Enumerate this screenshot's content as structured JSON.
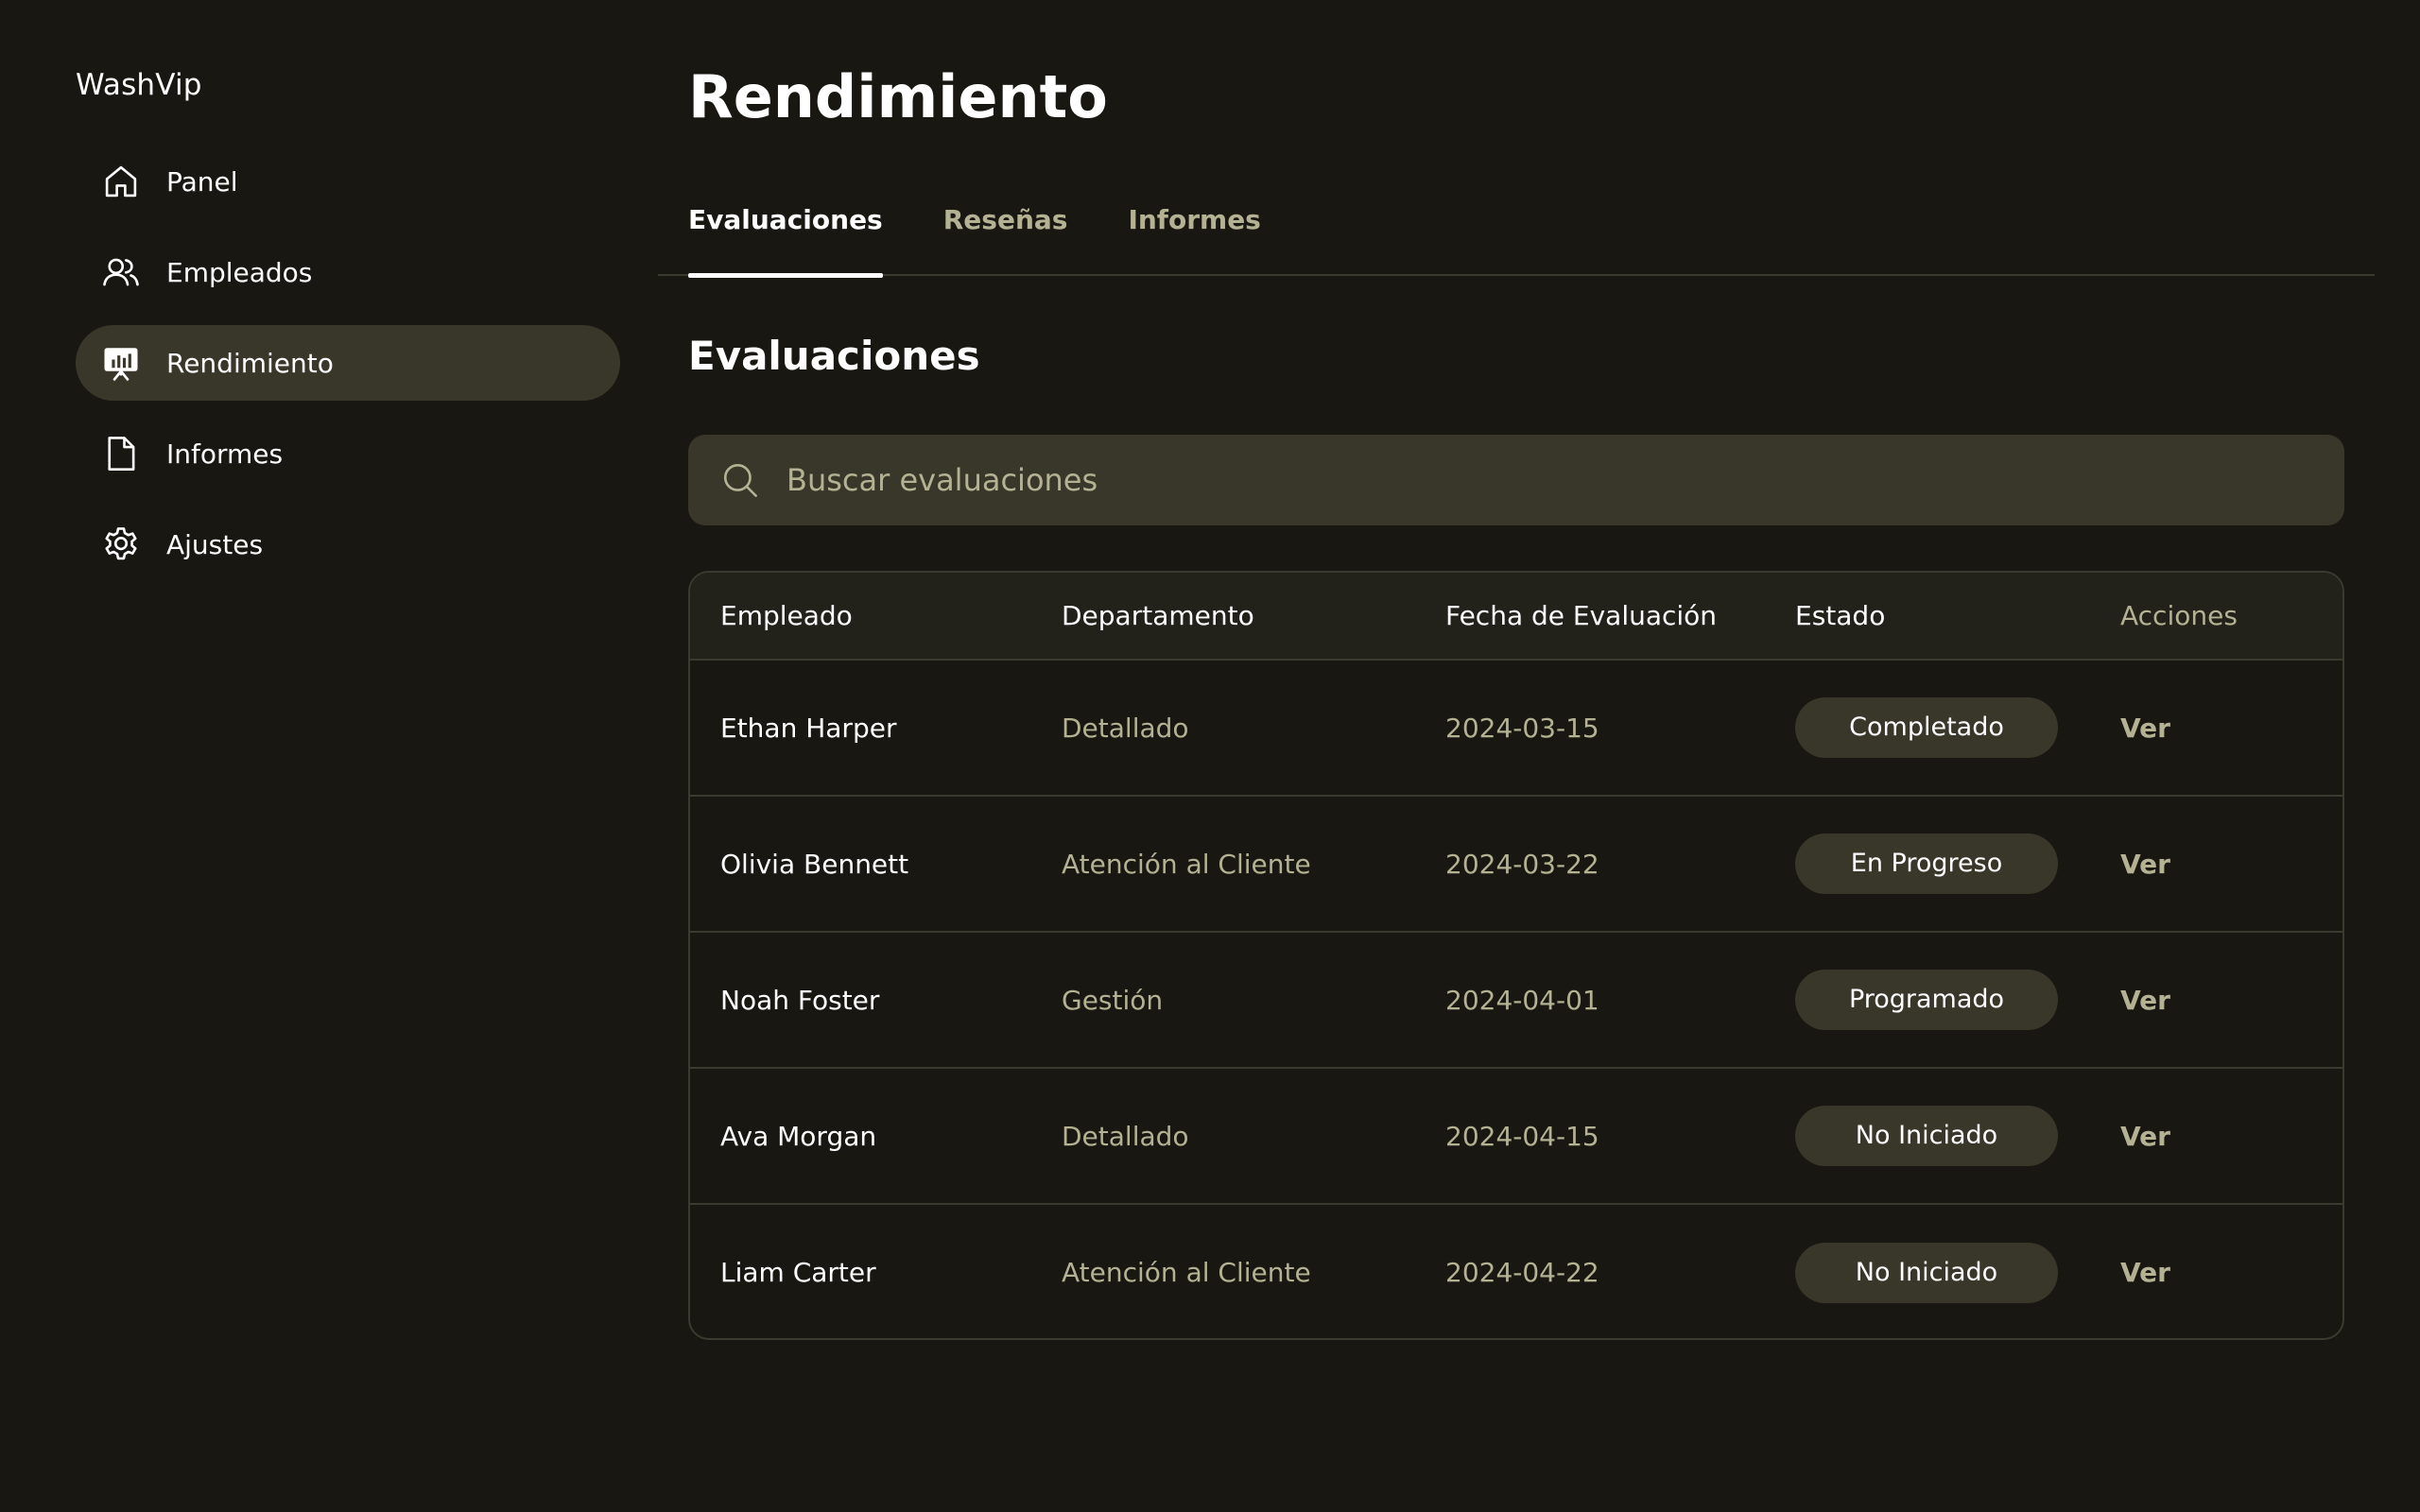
{
  "brand": "WashVip",
  "sidebar": {
    "items": [
      {
        "label": "Panel",
        "icon": "home-icon",
        "active": false
      },
      {
        "label": "Empleados",
        "icon": "users-icon",
        "active": false
      },
      {
        "label": "Rendimiento",
        "icon": "presentation-chart-icon",
        "active": true
      },
      {
        "label": "Informes",
        "icon": "document-icon",
        "active": false
      },
      {
        "label": "Ajustes",
        "icon": "gear-icon",
        "active": false
      }
    ]
  },
  "main": {
    "title": "Rendimiento",
    "tabs": [
      {
        "label": "Evaluaciones",
        "active": true
      },
      {
        "label": "Reseñas",
        "active": false
      },
      {
        "label": "Informes",
        "active": false
      }
    ],
    "section_title": "Evaluaciones",
    "search": {
      "placeholder": "Buscar evaluaciones",
      "value": ""
    },
    "table": {
      "headers": [
        "Empleado",
        "Departamento",
        "Fecha de Evaluación",
        "Estado",
        "Acciones"
      ],
      "rows": [
        {
          "employee": "Ethan Harper",
          "department": "Detallado",
          "date": "2024-03-15",
          "status": "Completado",
          "action": "Ver"
        },
        {
          "employee": "Olivia Bennett",
          "department": "Atención al Cliente",
          "date": "2024-03-22",
          "status": "En Progreso",
          "action": "Ver"
        },
        {
          "employee": "Noah Foster",
          "department": "Gestión",
          "date": "2024-04-01",
          "status": "Programado",
          "action": "Ver"
        },
        {
          "employee": "Ava Morgan",
          "department": "Detallado",
          "date": "2024-04-15",
          "status": "No Iniciado",
          "action": "Ver"
        },
        {
          "employee": "Liam Carter",
          "department": "Atención al Cliente",
          "date": "2024-04-22",
          "status": "No Iniciado",
          "action": "Ver"
        }
      ]
    }
  },
  "colors": {
    "background": "#181712",
    "surface": "#39372a",
    "border": "#3b3a2e",
    "muted_text": "#b4b293",
    "text": "#ffffff"
  }
}
